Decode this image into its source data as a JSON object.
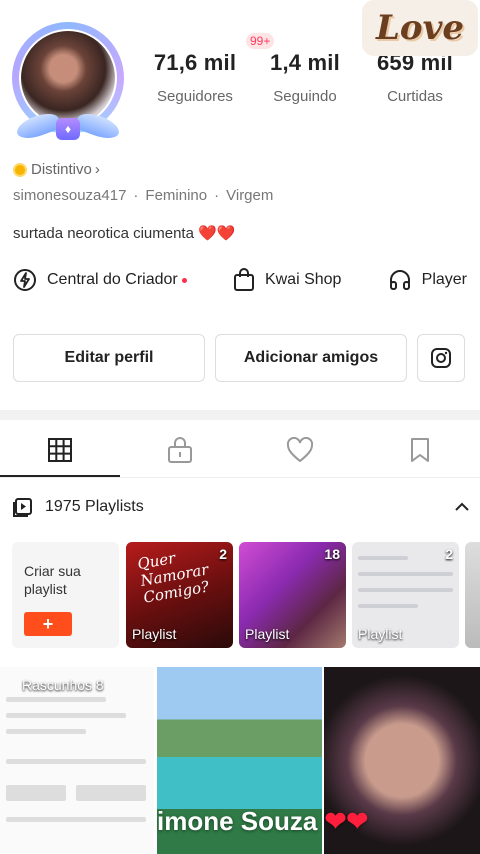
{
  "stats": {
    "notifications_badge": "99+",
    "items": [
      {
        "value": "71,6 mil",
        "label": "Seguidores"
      },
      {
        "value": "1,4 mil",
        "label": "Seguindo"
      },
      {
        "value": "659 mil",
        "label": "Curtidas"
      }
    ]
  },
  "sticker_text": "Love",
  "profile": {
    "badge": "Distintivo",
    "username": "simonesouza417",
    "gender": "Feminino",
    "sign": "Virgem",
    "bio": "surtada neorotica ciumenta",
    "bio_emoji": "❤️❤️"
  },
  "links": {
    "creator": "Central do Criador",
    "shop": "Kwai Shop",
    "player": "Player"
  },
  "buttons": {
    "edit": "Editar perfil",
    "add": "Adicionar amigos"
  },
  "playlists": {
    "title": "1975 Playlists",
    "create_label": "Criar sua playlist",
    "create_button": "+",
    "cards": [
      {
        "count": "2",
        "label": "Playlist",
        "overlay": "Quer Namorar Comigo?"
      },
      {
        "count": "18",
        "label": "Playlist"
      },
      {
        "count": "2",
        "label": "Playlist"
      }
    ]
  },
  "grid": {
    "drafts_label": "Rascunhos 8",
    "caption": "imone Souza",
    "caption_emoji": "❤❤"
  },
  "colors": {
    "accent": "#ff4d1c",
    "notification": "#ff3b5c"
  }
}
